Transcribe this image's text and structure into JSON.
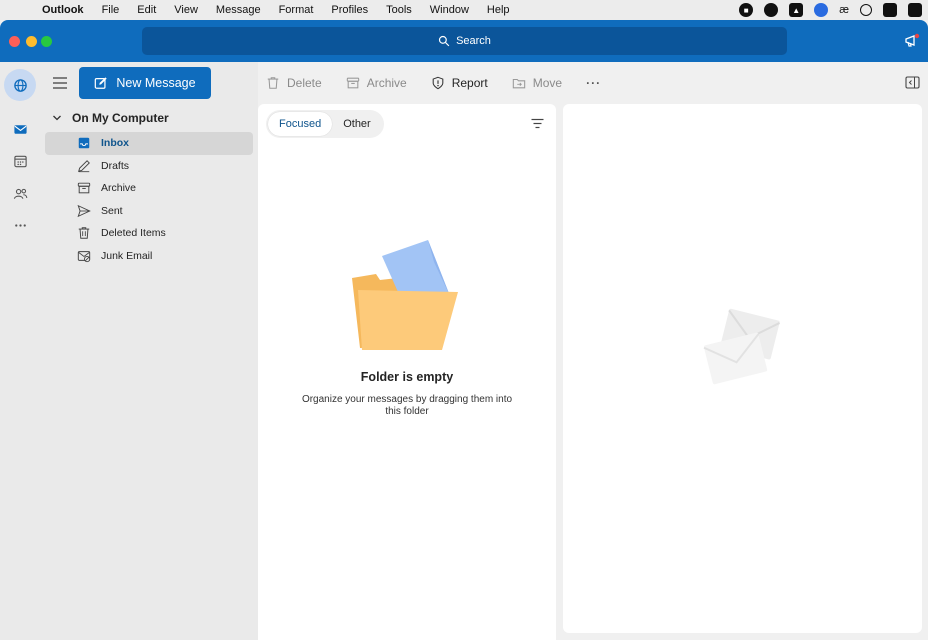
{
  "menubar": {
    "app_name": "Outlook",
    "items": [
      "File",
      "Edit",
      "View",
      "Message",
      "Format",
      "Profiles",
      "Tools",
      "Window",
      "Help"
    ],
    "status_icons": [
      "record-icon",
      "badge-icon",
      "drive-icon",
      "zoom-icon",
      "ae-icon",
      "play-icon",
      "app-icon"
    ]
  },
  "titlebar": {
    "search_label": "Search"
  },
  "toolbar": {
    "new_message_label": "New Message",
    "delete_label": "Delete",
    "archive_label": "Archive",
    "report_label": "Report",
    "move_label": "Move",
    "more_label": "···"
  },
  "sidebar": {
    "account_label": "On My Computer",
    "folders": [
      {
        "label": "Inbox",
        "icon": "inbox-icon"
      },
      {
        "label": "Drafts",
        "icon": "drafts-icon"
      },
      {
        "label": "Archive",
        "icon": "archive-icon"
      },
      {
        "label": "Sent",
        "icon": "sent-icon"
      },
      {
        "label": "Deleted Items",
        "icon": "trash-icon"
      },
      {
        "label": "Junk Email",
        "icon": "junk-icon"
      }
    ]
  },
  "message_list": {
    "tabs": [
      {
        "label": "Focused",
        "selected": true
      },
      {
        "label": "Other",
        "selected": false
      }
    ],
    "empty_title": "Folder is empty",
    "empty_subtitle": "Organize your messages by dragging them into this folder"
  },
  "colors": {
    "accent": "#0f6cbd",
    "search_bg": "#0b559a",
    "selected_folder": "#d6d6d6",
    "folder_illustration": "#fdca7a",
    "paper_illustration": "#a2c4f5"
  }
}
